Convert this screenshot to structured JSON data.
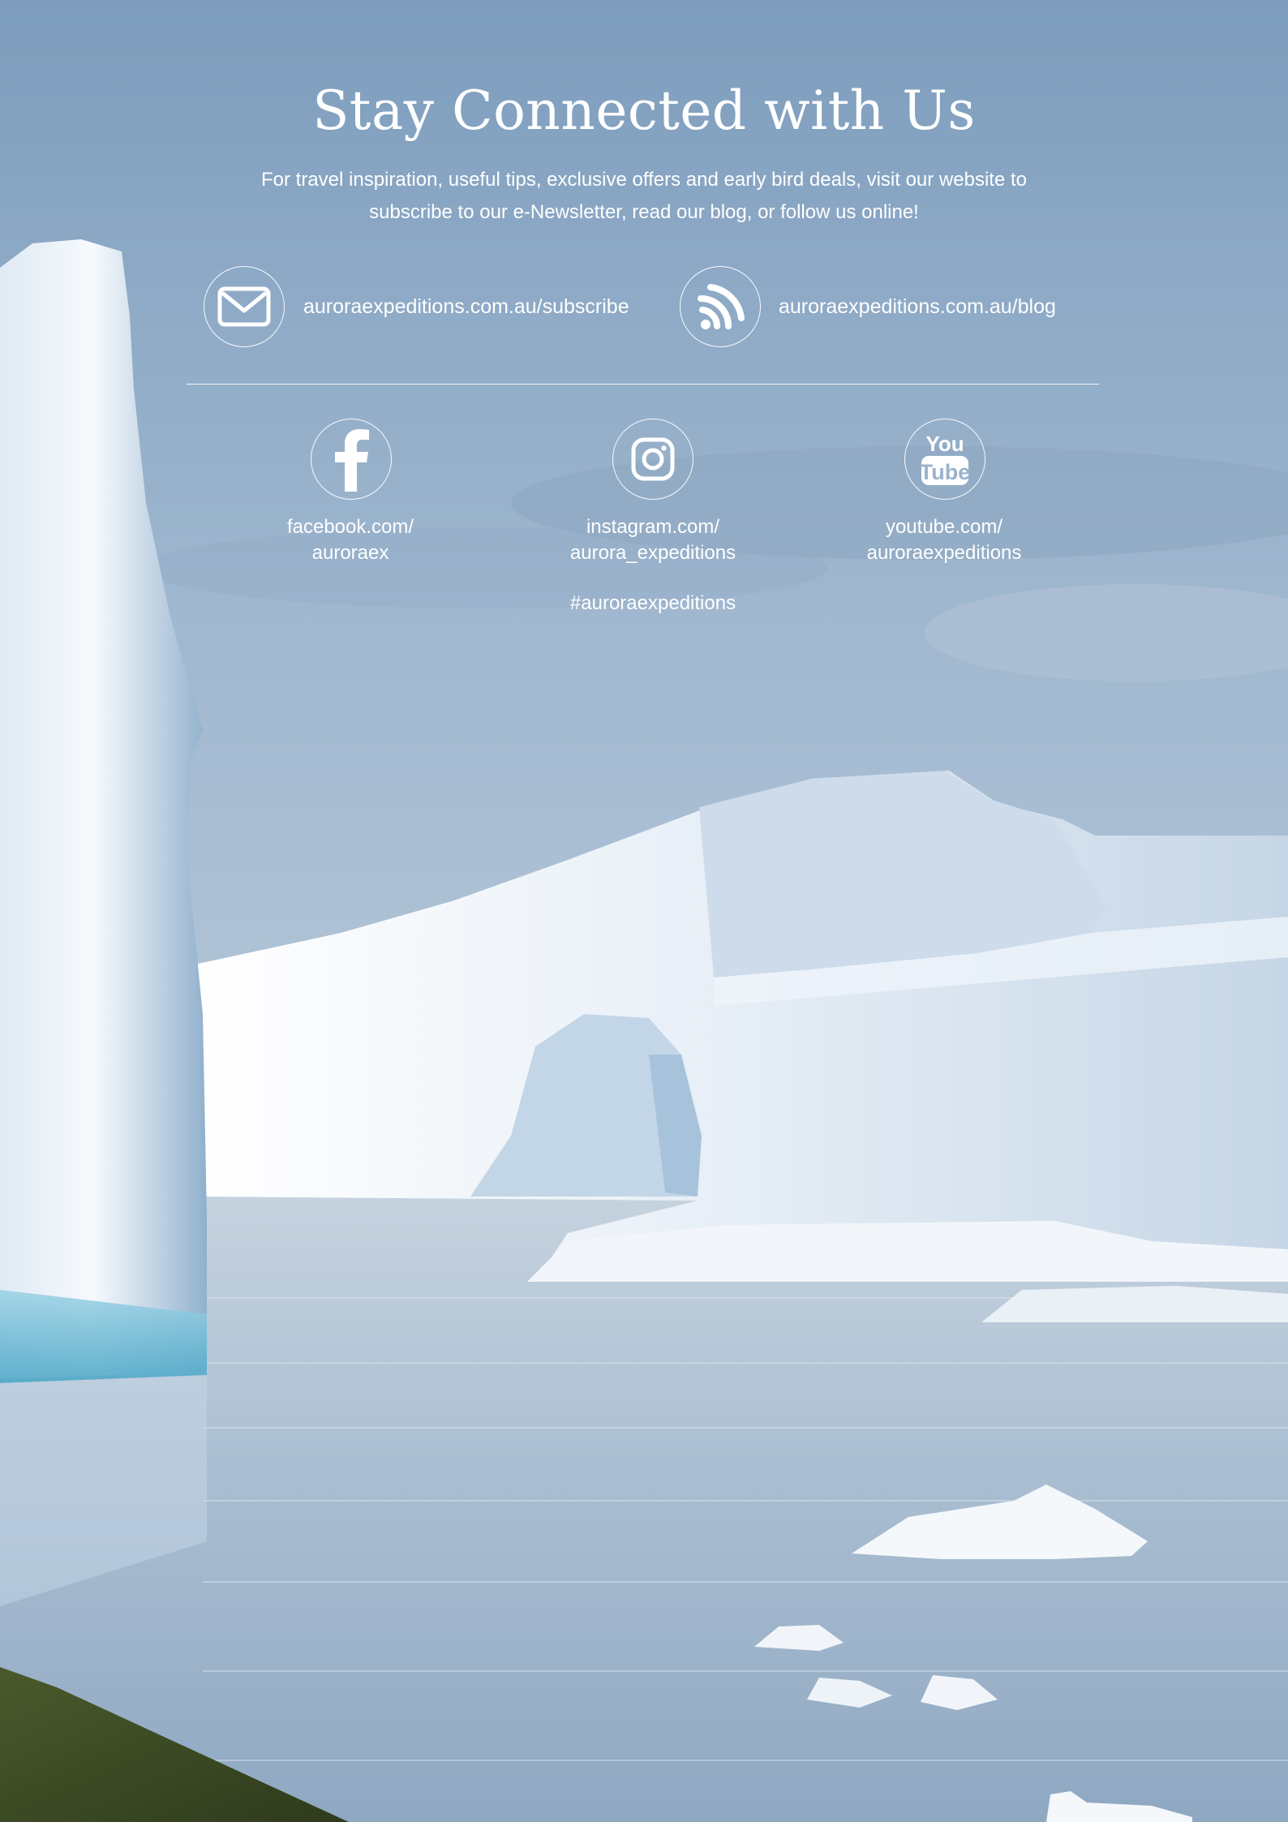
{
  "heading": {
    "title": "Stay Connected with Us",
    "intro": "For travel inspiration, useful tips, exclusive offers and early bird deals, visit our website to subscribe to our e-Newsletter, read our blog, or follow us online!"
  },
  "links": {
    "subscribe": {
      "icon": "envelope-icon",
      "text": "auroraexpeditions.com.au/subscribe"
    },
    "blog": {
      "icon": "rss-feed-icon",
      "text": "auroraexpeditions.com.au/blog"
    }
  },
  "social": {
    "facebook": {
      "icon": "facebook-icon",
      "line1": "facebook.com/",
      "line2": "auroraex"
    },
    "instagram": {
      "icon": "instagram-icon",
      "line1": "instagram.com/",
      "line2": "aurora_expeditions",
      "hashtag": "#auroraexpeditions"
    },
    "youtube": {
      "icon": "youtube-icon",
      "icon_text_top": "You",
      "icon_text_bottom": "Tube",
      "line1": "youtube.com/",
      "line2": "auroraexpeditions"
    }
  },
  "colors": {
    "text": "#ffffff",
    "sky": "#8fa9c4",
    "ice": "#eef3f8",
    "water": "#a9bed3"
  }
}
